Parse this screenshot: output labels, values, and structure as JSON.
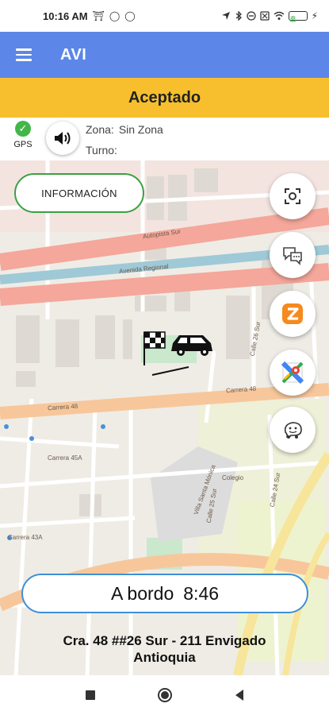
{
  "status_bar": {
    "time": "10:16 AM",
    "battery": "88"
  },
  "app_bar": {
    "title": "AVI"
  },
  "trip_status": "Aceptado",
  "driver_info": {
    "gps_label": "GPS",
    "zone_label": "Zona:",
    "zone_value": "Sin Zona",
    "shift_label": "Turno:",
    "shift_value": ""
  },
  "info_button_label": "INFORMACIÓN",
  "onboard": {
    "label": "A bordo",
    "time": "8:46"
  },
  "address": {
    "line1": "Cra. 48 ##26 Sur - 211 Envigado",
    "line2": "Antioquia"
  },
  "map": {
    "street_labels": {
      "autopista_sur": "Autopista Sur",
      "avenida_regional": "Avenida Regional",
      "carrera_48": "Carrera 48",
      "carrera_48b": "Carrera 48",
      "carrera_45a": "Carrera 45A",
      "carrera_43a": "Carrera 43A",
      "calle_26_sur": "Calle 26 Sur",
      "calle_25_sur": "Calle 25 Sur",
      "calle_24_sur": "Calle 24 Sur",
      "colegio": "Colegio",
      "villa_santa": "Villa Santa Mónica"
    }
  },
  "colors": {
    "app_bar": "#5c86e8",
    "status_banner": "#f7bf2e",
    "info_border": "#3aa043",
    "onboard_border": "#3f8fd8",
    "map_background": "#efece6",
    "highway": "#f4a79a",
    "primary_road": "#f7c79b"
  },
  "icons": {
    "menu": "hamburger-menu-icon",
    "sound": "speaker-icon",
    "center": "center-focus-icon",
    "chat": "chat-icon",
    "zello": "zello-icon",
    "maps": "google-maps-icon",
    "waze": "waze-icon",
    "vehicle": "car-flag-marker-icon"
  }
}
